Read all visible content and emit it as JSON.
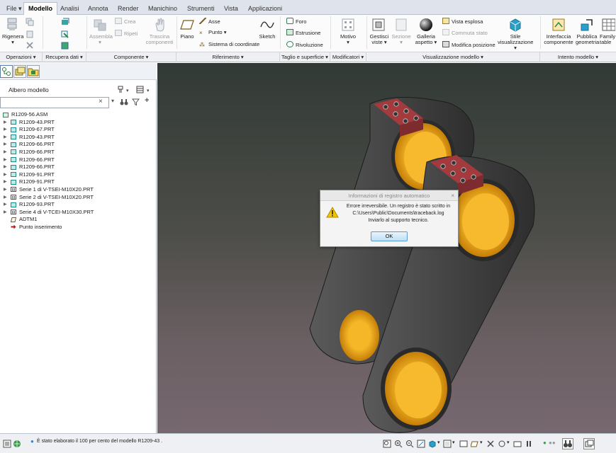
{
  "tabs": [
    {
      "label": "File",
      "active": false
    },
    {
      "label": "Modello",
      "active": true
    },
    {
      "label": "Analisi",
      "active": false
    },
    {
      "label": "Annota",
      "active": false
    },
    {
      "label": "Render",
      "active": false
    },
    {
      "label": "Manichino",
      "active": false
    },
    {
      "label": "Strumenti",
      "active": false
    },
    {
      "label": "Vista",
      "active": false
    },
    {
      "label": "Applicazioni",
      "active": false
    }
  ],
  "ribbon": {
    "rigenera": "Rigenera",
    "assembla": "Assembla",
    "crea": "Crea",
    "ripeti": "Ripeti",
    "trascina_componenti": [
      "Trascina",
      "componenti"
    ],
    "piano": "Piano",
    "asse": "Asse",
    "punto": "Punto",
    "sistema_coordinate": "Sistema di coordinate",
    "sketch": "Sketch",
    "foro": "Foro",
    "estrusione": "Estrusione",
    "rivoluzione": "Rivoluzione",
    "motivo": "Motivo",
    "gestisci_viste": [
      "Gestisci",
      "viste"
    ],
    "sezione": "Sezione",
    "galleria_aspetto": [
      "Galleria",
      "aspetto"
    ],
    "vista_esplosa": "Vista esplosa",
    "commuta_stato": "Commuta stato",
    "modifica_posizione": "Modifica posizione",
    "stile_visualizzazione": [
      "Stile",
      "visualizzazione"
    ],
    "interfaccia_componente": [
      "Interfaccia",
      "componente"
    ],
    "pubblica_geometria": [
      "Pubblica",
      "geometria"
    ],
    "family_table": [
      "Family",
      "table"
    ]
  },
  "groups": {
    "operazioni": "Operazioni",
    "recupera_dati": "Recupera dati",
    "componente": "Componente",
    "riferimento": "Riferimento",
    "taglio_superficie": "Taglio e superficie",
    "modificatori": "Modificatori",
    "visualizzazione_modello": "Visualizzazione modello",
    "intento_modello": "Intento modello"
  },
  "panel": {
    "title": "Albero modello",
    "search_value": "",
    "tree": [
      {
        "label": "R1209-56.ASM",
        "type": "asm",
        "expandable": false,
        "indent": 0
      },
      {
        "label": "R1209-43.PRT",
        "type": "prt",
        "expandable": true,
        "indent": 1
      },
      {
        "label": "R1209-67.PRT",
        "type": "prt",
        "expandable": true,
        "indent": 1
      },
      {
        "label": "R1209-43.PRT",
        "type": "prt",
        "expandable": true,
        "indent": 1
      },
      {
        "label": "R1209-66.PRT",
        "type": "prt",
        "expandable": true,
        "indent": 1
      },
      {
        "label": "R1209-66.PRT",
        "type": "prt",
        "expandable": true,
        "indent": 1
      },
      {
        "label": "R1209-66.PRT",
        "type": "prt",
        "expandable": true,
        "indent": 1
      },
      {
        "label": "R1209-66.PRT",
        "type": "prt",
        "expandable": true,
        "indent": 1
      },
      {
        "label": "R1209-91.PRT",
        "type": "prt",
        "expandable": true,
        "indent": 1
      },
      {
        "label": "R1209-91.PRT",
        "type": "prt",
        "expandable": true,
        "indent": 1
      },
      {
        "label": "Serie 1 di V-TSEI-M10X20.PRT",
        "type": "serie",
        "expandable": true,
        "indent": 1
      },
      {
        "label": "Serie 2 di V-TSEI-M10X20.PRT",
        "type": "serie",
        "expandable": true,
        "indent": 1
      },
      {
        "label": "R1209-93.PRT",
        "type": "prt",
        "expandable": true,
        "indent": 1
      },
      {
        "label": "Serie 4 di V-TCEI-M10X30.PRT",
        "type": "serie",
        "expandable": true,
        "indent": 1
      },
      {
        "label": "ADTM1",
        "type": "datum",
        "expandable": false,
        "indent": 1
      },
      {
        "label": "Punto inserimento",
        "type": "insert",
        "expandable": false,
        "indent": 1
      }
    ]
  },
  "dialog": {
    "title": "Informazioni di registro automatico",
    "lines": [
      "Errore irreversibile. Un registro è stato scritto in",
      "C:\\Users\\Public\\Documents\\traceback.log",
      "Inviarlo al supporto tecnico."
    ],
    "ok_label": "OK"
  },
  "status": {
    "message": "È stato elaborato il 100 per cento del modello R1209-43 ."
  },
  "colors": {
    "accent": "#3d7fc1",
    "part_body": "#3f3f3f",
    "bearing": "#e8a010",
    "bolt_block": "#9e3b3e"
  }
}
